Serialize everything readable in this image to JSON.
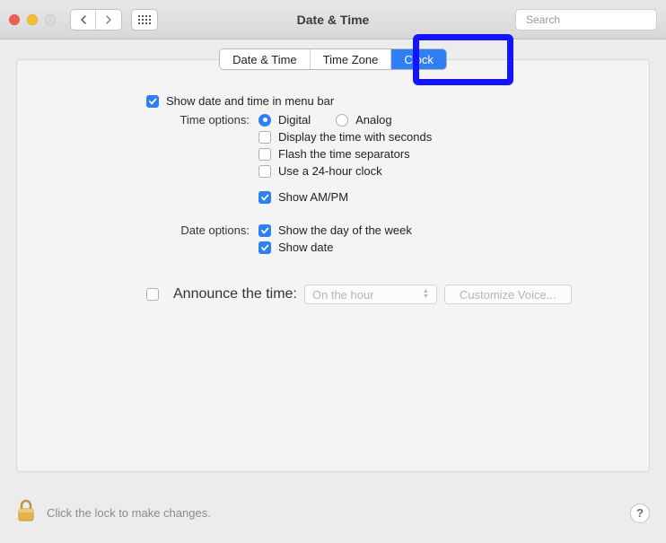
{
  "window": {
    "title": "Date & Time"
  },
  "search": {
    "placeholder": "Search"
  },
  "tabs": {
    "date_time": "Date & Time",
    "time_zone": "Time Zone",
    "clock": "Clock",
    "active": "clock"
  },
  "main": {
    "show_in_menubar": "Show date and time in menu bar",
    "time_options_label": "Time options:",
    "digital": "Digital",
    "analog": "Analog",
    "with_seconds": "Display the time with seconds",
    "flash_separators": "Flash the time separators",
    "use_24h": "Use a 24-hour clock",
    "show_ampm": "Show AM/PM",
    "date_options_label": "Date options:",
    "show_dow": "Show the day of the week",
    "show_date": "Show date",
    "announce_label": "Announce the time:",
    "announce_interval": "On the hour",
    "customize_voice": "Customize Voice..."
  },
  "footer": {
    "lock_text": "Click the lock to make changes.",
    "help": "?"
  }
}
